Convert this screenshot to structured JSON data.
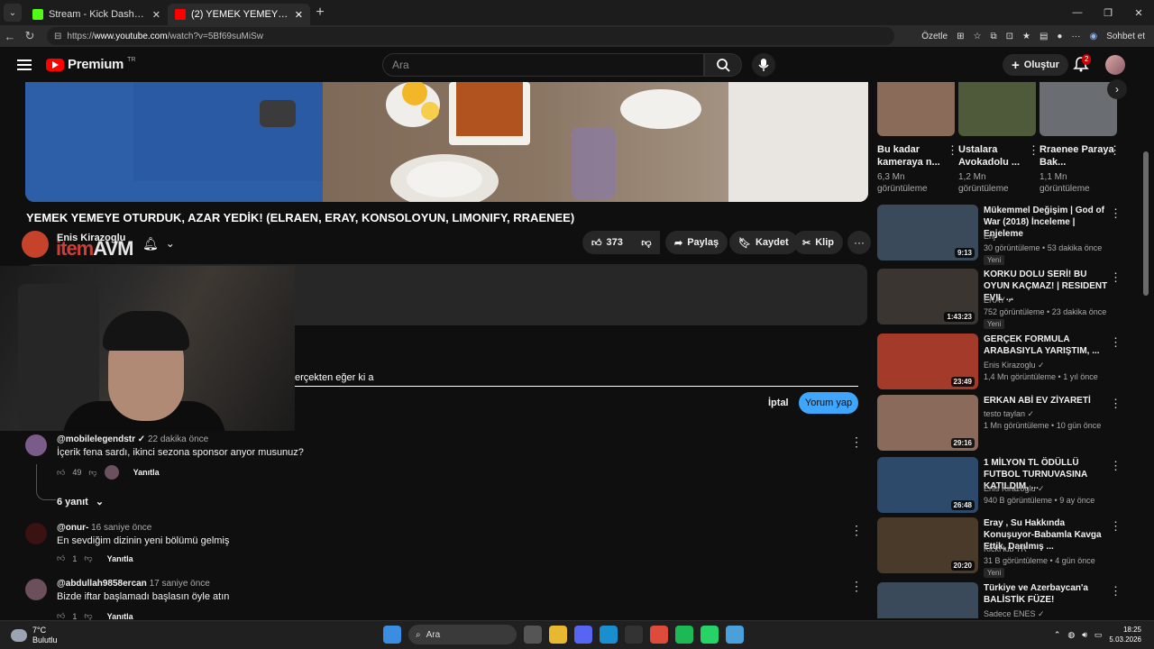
{
  "browser": {
    "tabs": [
      {
        "title": "Stream - Kick Dashboard",
        "fav_color": "#53fc18"
      },
      {
        "title": "(2) YEMEK YEMEYE OTURDUK, AZAR",
        "fav_color": "#ff0000"
      }
    ],
    "url_prefix": "https://",
    "url_host": "www.youtube.com",
    "url_path": "/watch?v=5Bf69suMiSw",
    "summarize": "Özetle",
    "chat": "Sohbet et"
  },
  "youtube": {
    "logo": "Premium",
    "region": "TR",
    "search_placeholder": "Ara",
    "create_label": "Oluştur",
    "notif_count": "2"
  },
  "video": {
    "title": "YEMEK YEMEYE OTURDUK, AZAR YEDİK! (ELRAEN, ERAY, KONSOLOYUN, LIMONIFY, RRAENEE)",
    "channel": "Enis Kirazoglu",
    "overlay_text_a": "item",
    "overlay_text_b": "AVM",
    "likes": "373",
    "share": "Paylaş",
    "save": "Kaydet",
    "clip": "Klip"
  },
  "comment_box": {
    "value": "erçekten eğer ki a",
    "cancel": "İptal",
    "submit": "Yorum yap"
  },
  "comments": [
    {
      "author": "@mobilelegendstr ✓",
      "time": "22 dakika önce",
      "text": "İçerik fena sardı, ikinci sezona sponsor anyor musunuz?",
      "likes": "49",
      "reply": "Yanıtla",
      "avatar_color": "#7a5c8a"
    },
    {
      "author": "@onur-",
      "time": "16 saniye önce",
      "text": "En sevdiğim dizinin yeni bölümü gelmiş",
      "likes": "1",
      "reply": "Yanıtla",
      "avatar_color": "#3a1212"
    },
    {
      "author": "@abdullah9858ercan",
      "time": "17 saniye önce",
      "text": "Bizde iftar başlamadı başlasın öyle atın",
      "likes": "1",
      "reply": "Yanıtla",
      "avatar_color": "#6b4f5a"
    }
  ],
  "replies_label": "6 yanıt",
  "shorts": [
    {
      "title": "Bu kadar kameraya n...",
      "views": "6,3 Mn görüntüleme",
      "color": "#8a6b5a"
    },
    {
      "title": "Ustalara Avokadolu ...",
      "views": "1,2 Mn görüntüleme",
      "color": "#4f5a3a"
    },
    {
      "title": "Rraenee Paraya Bak...",
      "views": "1,1 Mn görüntüleme",
      "color": "#6a6e72"
    }
  ],
  "recommendations": [
    {
      "title": "Mükemmel Değişim | God of War (2018) İnceleme | Enjeleme",
      "channel": "Enj",
      "meta": "30 görüntüleme • 53 dakika önce",
      "new": "Yeni",
      "duration": "9:13",
      "color": "#3b4a5a"
    },
    {
      "title": "KORKU DOLU SERİ! BU OYUN KAÇMAZ! | RESIDENT EVIL ...",
      "channel": "ERAY ✓",
      "meta": "752 görüntüleme • 23 dakika önce",
      "new": "Yeni",
      "duration": "1:43:23",
      "color": "#3a3530"
    },
    {
      "title": "GERÇEK FORMULA ARABASIYLA YARIŞTIM, ...",
      "channel": "Enis Kirazoglu ✓",
      "meta": "1,4 Mn görüntüleme • 1 yıl önce",
      "new": "",
      "duration": "23:49",
      "color": "#a33a2a"
    },
    {
      "title": "ERKAN ABİ EV ZİYARETİ",
      "channel": "testo taylan ✓",
      "meta": "1 Mn görüntüleme • 10 gün önce",
      "new": "",
      "duration": "29:16",
      "color": "#8a6a5a"
    },
    {
      "title": "1 MİLYON TL ÖDÜLLÜ FUTBOL TURNUVASINA KATILDIM, ...",
      "channel": "Enis Kirazoglu ✓",
      "meta": "940 B görüntüleme • 9 ay önce",
      "new": "",
      "duration": "26:48",
      "color": "#2d4a6a"
    },
    {
      "title": "Eray , Su Hakkında Konuşuyor-Babamla Kavga Ettik, Darılmış ...",
      "channel": "KickHub TR",
      "meta": "31 B görüntüleme • 4 gün önce",
      "new": "Yeni",
      "duration": "20:20",
      "color": "#4a3a2a"
    },
    {
      "title": "Türkiye ve Azerbaycan'a BALİSTİK FÜZE!",
      "channel": "Sadece ENES ✓",
      "meta": "",
      "new": "",
      "duration": "",
      "color": "#3a4a5a"
    }
  ],
  "taskbar": {
    "temp": "7°C",
    "weather": "Bulutlu",
    "search": "Ara",
    "time": "18:25",
    "date": "5.03.2026"
  }
}
